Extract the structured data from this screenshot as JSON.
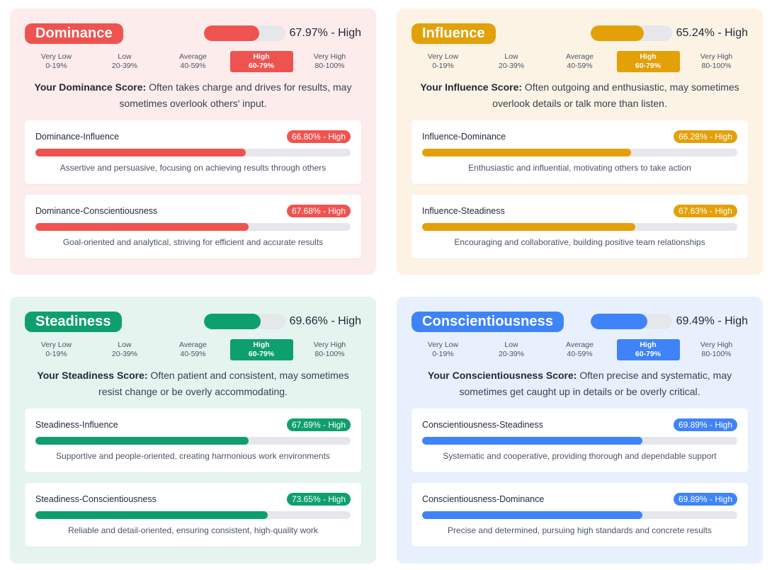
{
  "levels": [
    {
      "label": "Very Low",
      "range": "0-19%"
    },
    {
      "label": "Low",
      "range": "20-39%"
    },
    {
      "label": "Average",
      "range": "40-59%"
    },
    {
      "label": "High",
      "range": "60-79%"
    },
    {
      "label": "Very High",
      "range": "80-100%"
    }
  ],
  "traits": [
    {
      "key": "dominance",
      "name": "Dominance",
      "color": "#ef5350",
      "bg": "#fdecec",
      "score_percent": 67.97,
      "score_text": "67.97% - High",
      "active_level_index": 3,
      "summary_label": "Your Dominance Score:",
      "summary_text": " Often takes charge and drives for results, may sometimes overlook others' input.",
      "subtraits": [
        {
          "name": "Dominance-Influence",
          "percent": 66.8,
          "badge": "66.80% - High",
          "description": "Assertive and persuasive, focusing on achieving results through others"
        },
        {
          "name": "Dominance-Conscientiousness",
          "percent": 67.68,
          "badge": "67.68% - High",
          "description": "Goal-oriented and analytical, striving for efficient and accurate results"
        }
      ]
    },
    {
      "key": "influence",
      "name": "Influence",
      "color": "#e3a008",
      "bg": "#fcf3e4",
      "score_percent": 65.24,
      "score_text": "65.24% - High",
      "active_level_index": 3,
      "summary_label": "Your Influence Score:",
      "summary_text": " Often outgoing and enthusiastic, may sometimes overlook details or talk more than listen.",
      "subtraits": [
        {
          "name": "Influence-Dominance",
          "percent": 66.28,
          "badge": "66.28% - High",
          "description": "Enthusiastic and influential, motivating others to take action"
        },
        {
          "name": "Influence-Steadiness",
          "percent": 67.63,
          "badge": "67.63% - High",
          "description": "Encouraging and collaborative, building positive team relationships"
        }
      ]
    },
    {
      "key": "steadiness",
      "name": "Steadiness",
      "color": "#0e9f6e",
      "bg": "#e5f4ef",
      "score_percent": 69.66,
      "score_text": "69.66% - High",
      "active_level_index": 3,
      "summary_label": "Your Steadiness Score:",
      "summary_text": " Often patient and consistent, may sometimes resist change or be overly accommodating.",
      "subtraits": [
        {
          "name": "Steadiness-Influence",
          "percent": 67.69,
          "badge": "67.69% - High",
          "description": "Supportive and people-oriented, creating harmonious work environments"
        },
        {
          "name": "Steadiness-Conscientiousness",
          "percent": 73.65,
          "badge": "73.65% - High",
          "description": "Reliable and detail-oriented, ensuring consistent, high-quality work"
        }
      ]
    },
    {
      "key": "conscientiousness",
      "name": "Conscientiousness",
      "color": "#3f83f8",
      "bg": "#e9f0fd",
      "score_percent": 69.49,
      "score_text": "69.49% - High",
      "active_level_index": 3,
      "summary_label": "Your Conscientiousness Score:",
      "summary_text": " Often precise and systematic, may sometimes get caught up in details or be overly critical.",
      "subtraits": [
        {
          "name": "Conscientiousness-Steadiness",
          "percent": 69.89,
          "badge": "69.89% - High",
          "description": "Systematic and cooperative, providing thorough and dependable support"
        },
        {
          "name": "Conscientiousness-Dominance",
          "percent": 69.89,
          "badge": "69.89% - High",
          "description": "Precise and determined, pursuing high standards and concrete results"
        }
      ]
    }
  ]
}
